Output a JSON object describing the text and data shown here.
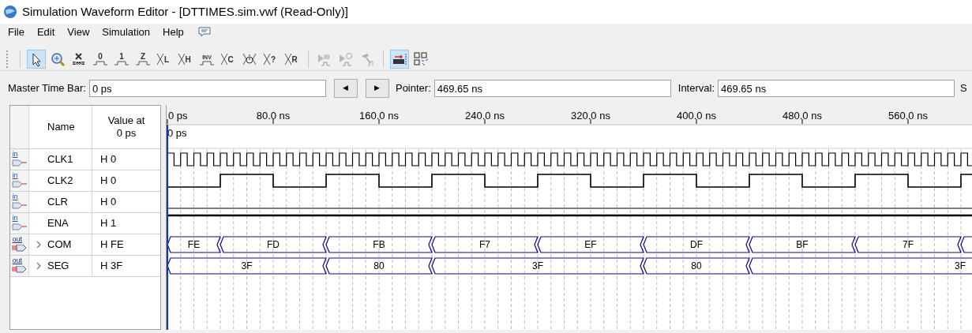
{
  "window": {
    "title": "Simulation Waveform Editor - [DTTIMES.sim.vwf (Read-Only)]"
  },
  "menu": [
    "File",
    "Edit",
    "View",
    "Simulation",
    "Help"
  ],
  "toolbar": [
    {
      "kind": "pointer",
      "selected": true
    },
    {
      "kind": "zoom",
      "selected": false
    },
    {
      "kind": "unknown",
      "selected": false
    },
    {
      "kind": "level",
      "glyph": "0",
      "selected": false
    },
    {
      "kind": "level",
      "glyph": "1",
      "selected": false
    },
    {
      "kind": "level",
      "glyph": "Z",
      "selected": false
    },
    {
      "kind": "bus",
      "glyph": "L",
      "selected": false
    },
    {
      "kind": "bus",
      "glyph": "H",
      "selected": false
    },
    {
      "kind": "level",
      "glyph": "INV",
      "selected": false
    },
    {
      "kind": "bus",
      "glyph": "C",
      "selected": false
    },
    {
      "kind": "timer",
      "selected": false
    },
    {
      "kind": "bus",
      "glyph": "?",
      "selected": false
    },
    {
      "kind": "bus",
      "glyph": "R",
      "selected": false
    },
    {
      "kind": "separator"
    },
    {
      "kind": "run",
      "selected": false
    },
    {
      "kind": "run_timing",
      "selected": false
    },
    {
      "kind": "hammer",
      "selected": false
    },
    {
      "kind": "separator"
    },
    {
      "kind": "snap",
      "selected": true
    },
    {
      "kind": "grid",
      "selected": false
    }
  ],
  "time_bar": {
    "master_label": "Master Time Bar:",
    "master_value": "0 ps",
    "prev": "◀",
    "next": "▶",
    "pointer_label": "Pointer:",
    "pointer_value": "469.65 ns",
    "interval_label": "Interval:",
    "interval_value": "469.65 ns",
    "cut_label": "S"
  },
  "signals_header": {
    "name": "Name",
    "value": "Value at 0 ps"
  },
  "signals": [
    {
      "direction": "in",
      "name": "CLK1",
      "value": "H 0",
      "kind": "clock_fast"
    },
    {
      "direction": "in",
      "name": "CLK2",
      "value": "H 0",
      "kind": "clock_slow"
    },
    {
      "direction": "in",
      "name": "CLR",
      "value": "H 0",
      "kind": "low"
    },
    {
      "direction": "in",
      "name": "ENA",
      "value": "H 1",
      "kind": "high"
    },
    {
      "direction": "out",
      "name": "COM",
      "value": "H FE",
      "kind": "bus",
      "expanded": false,
      "segments": [
        "FE",
        "FD",
        "FB",
        "F7",
        "EF",
        "DF",
        "BF",
        "7F"
      ]
    },
    {
      "direction": "out",
      "name": "SEG",
      "value": "H 3F",
      "kind": "bus",
      "expanded": false,
      "segments": [
        "3F",
        "80",
        "3F",
        "80",
        "3F"
      ]
    }
  ],
  "ruler": {
    "ticks": [
      "0 ps",
      "80.0 ns",
      "160.0 ns",
      "240.0 ns",
      "320.0 ns",
      "400.0 ns",
      "480.0 ns",
      "560.0 ns"
    ],
    "cursor": "0 ps"
  }
}
